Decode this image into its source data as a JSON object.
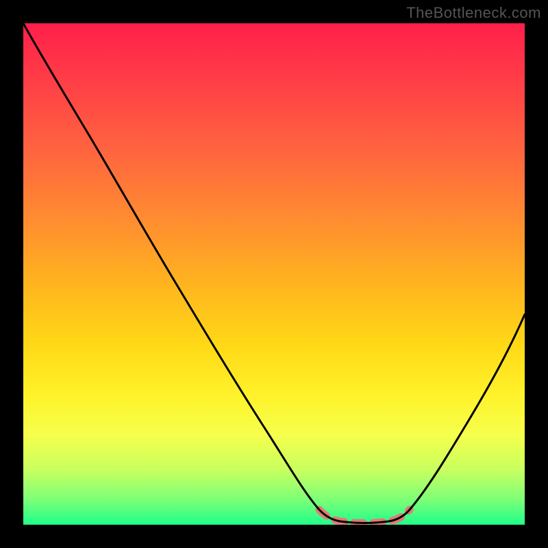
{
  "watermark": "TheBottleneck.com",
  "chart_data": {
    "type": "line",
    "title": "",
    "xlabel": "",
    "ylabel": "",
    "x_range": [
      0,
      1
    ],
    "y_range": [
      0,
      1
    ],
    "curve_points": [
      {
        "x": 0.0,
        "y": 1.0
      },
      {
        "x": 0.05,
        "y": 0.94
      },
      {
        "x": 0.1,
        "y": 0.86
      },
      {
        "x": 0.15,
        "y": 0.78
      },
      {
        "x": 0.2,
        "y": 0.7
      },
      {
        "x": 0.25,
        "y": 0.61
      },
      {
        "x": 0.3,
        "y": 0.52
      },
      {
        "x": 0.35,
        "y": 0.43
      },
      {
        "x": 0.4,
        "y": 0.34
      },
      {
        "x": 0.45,
        "y": 0.25
      },
      {
        "x": 0.5,
        "y": 0.16
      },
      {
        "x": 0.55,
        "y": 0.08
      },
      {
        "x": 0.59,
        "y": 0.03
      },
      {
        "x": 0.63,
        "y": 0.01
      },
      {
        "x": 0.68,
        "y": 0.0
      },
      {
        "x": 0.73,
        "y": 0.01
      },
      {
        "x": 0.77,
        "y": 0.03
      },
      {
        "x": 0.82,
        "y": 0.1
      },
      {
        "x": 0.88,
        "y": 0.2
      },
      {
        "x": 0.94,
        "y": 0.31
      },
      {
        "x": 1.0,
        "y": 0.42
      }
    ],
    "highlighted_segment": {
      "x_start": 0.59,
      "x_end": 0.77,
      "color": "#e27a74"
    },
    "background_gradient": {
      "stops": [
        {
          "pos": 0.0,
          "color": "#ff1f4a"
        },
        {
          "pos": 0.5,
          "color": "#ffc41a"
        },
        {
          "pos": 0.8,
          "color": "#fcff3e"
        },
        {
          "pos": 1.0,
          "color": "#1fff8a"
        }
      ],
      "direction": "top-to-bottom"
    },
    "annotations": [],
    "legend": []
  }
}
